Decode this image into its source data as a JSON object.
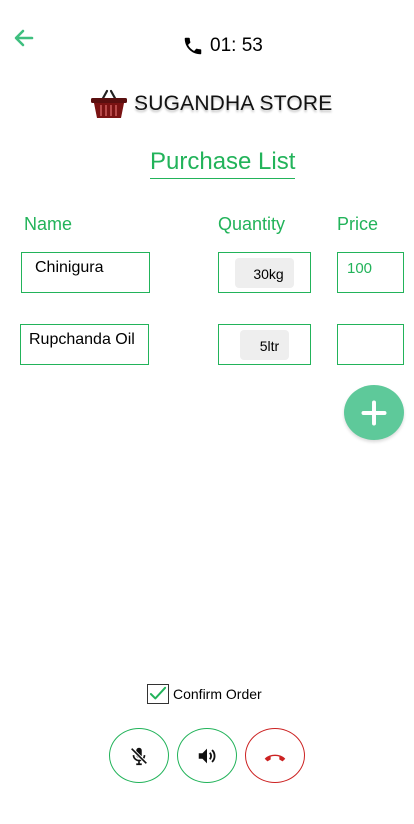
{
  "header": {
    "call_time": "01: 53"
  },
  "store": {
    "name": "SUGANDHA STORE"
  },
  "list": {
    "title": "Purchase List",
    "columns": {
      "name": "Name",
      "quantity": "Quantity",
      "price": "Price"
    },
    "rows": [
      {
        "name": "Chinigura",
        "quantity": "30kg",
        "price": "100"
      },
      {
        "name": "Rupchanda Oil",
        "quantity": "5ltr",
        "price": ""
      }
    ]
  },
  "footer": {
    "confirm_label": "Confirm Order",
    "confirm_checked": true
  },
  "icons": {
    "back": "arrow-left-icon",
    "phone": "phone-icon",
    "basket": "basket-icon",
    "add": "plus-icon",
    "mute": "mic-off-icon",
    "speaker": "speaker-icon",
    "end_call": "end-call-icon"
  },
  "colors": {
    "accent": "#22b35a",
    "fab": "#5ec99a",
    "danger": "#cc2222"
  }
}
